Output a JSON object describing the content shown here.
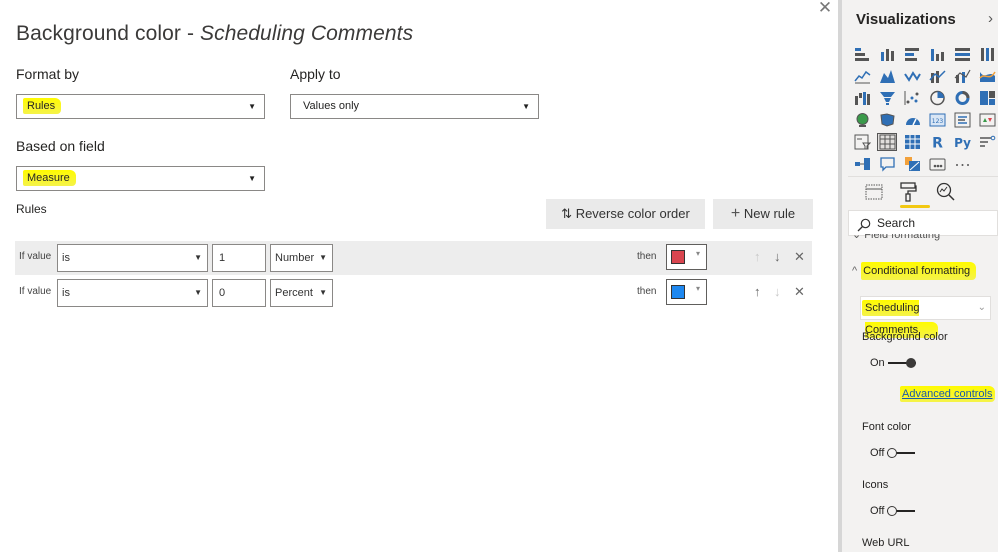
{
  "dialog": {
    "title_prefix": "Background color - ",
    "title_field": "Scheduling Comments",
    "close_icon": "close-icon",
    "format_by": {
      "label": "Format by",
      "value": "Rules"
    },
    "apply_to": {
      "label": "Apply to",
      "value": "Values only"
    },
    "based_on_field": {
      "label": "Based on field",
      "value": "Measure"
    },
    "rules_label": "Rules",
    "reverse_button": {
      "icon": "sort-arrows-icon",
      "glyph": "⇅",
      "label": "Reverse color order"
    },
    "new_rule_button": {
      "icon": "plus-icon",
      "glyph": "+",
      "label": "New rule"
    },
    "rules": [
      {
        "if_label": "If value",
        "condition": "is",
        "value": "1",
        "type": "Number",
        "then_label": "then",
        "color": "#d9454f",
        "up_enabled": false,
        "down_enabled": true
      },
      {
        "if_label": "If value",
        "condition": "is",
        "value": "0",
        "type": "Percent",
        "then_label": "then",
        "color": "#1e88f0",
        "up_enabled": true,
        "down_enabled": false
      }
    ],
    "glyphs": {
      "up": "↑",
      "down": "↓",
      "remove": "✕",
      "dropdown": "▼",
      "swatch_dropdown": "▾",
      "close": "✕"
    }
  },
  "pane": {
    "title": "Visualizations",
    "collapse_glyph": "›",
    "visuals": [
      "stacked-bar-chart-icon",
      "stacked-column-chart-icon",
      "clustered-bar-chart-icon",
      "clustered-column-chart-icon",
      "100-stacked-bar-chart-icon",
      "100-stacked-column-chart-icon",
      "line-chart-icon",
      "area-chart-icon",
      "stacked-area-chart-icon",
      "line-and-stacked-column-icon",
      "line-and-clustered-column-icon",
      "ribbon-chart-icon",
      "waterfall-chart-icon",
      "funnel-icon",
      "scatter-chart-icon",
      "pie-chart-icon",
      "donut-chart-icon",
      "treemap-icon",
      "map-icon",
      "filled-map-icon",
      "gauge-icon",
      "card-icon",
      "multi-row-card-icon",
      "kpi-icon",
      "slicer-icon",
      "table-icon",
      "matrix-icon",
      "r-visual-icon",
      "python-visual-icon",
      "key-influencers-icon",
      "decomposition-tree-icon",
      "qa-icon",
      "smart-narrative-icon",
      "paginated-report-icon",
      "more-visuals-icon"
    ],
    "tabs": [
      "fields-tab-icon",
      "format-paint-roller-icon",
      "analytics-icon"
    ],
    "search_placeholder": "Search",
    "field_formatting_label": "Field formatting",
    "conditional_formatting_label": "Conditional formatting",
    "field_dropdown_value": "Scheduling Comments",
    "background_color": {
      "label": "Background color",
      "state": "On"
    },
    "advanced_controls_link": "Advanced controls",
    "font_color": {
      "label": "Font color",
      "state": "Off"
    },
    "icons": {
      "label": "Icons",
      "state": "Off"
    },
    "web_url_label": "Web URL"
  },
  "colors": {
    "highlight": "#ffff00",
    "accent_underline": "#f2c811",
    "link": "#1a5aa8"
  }
}
